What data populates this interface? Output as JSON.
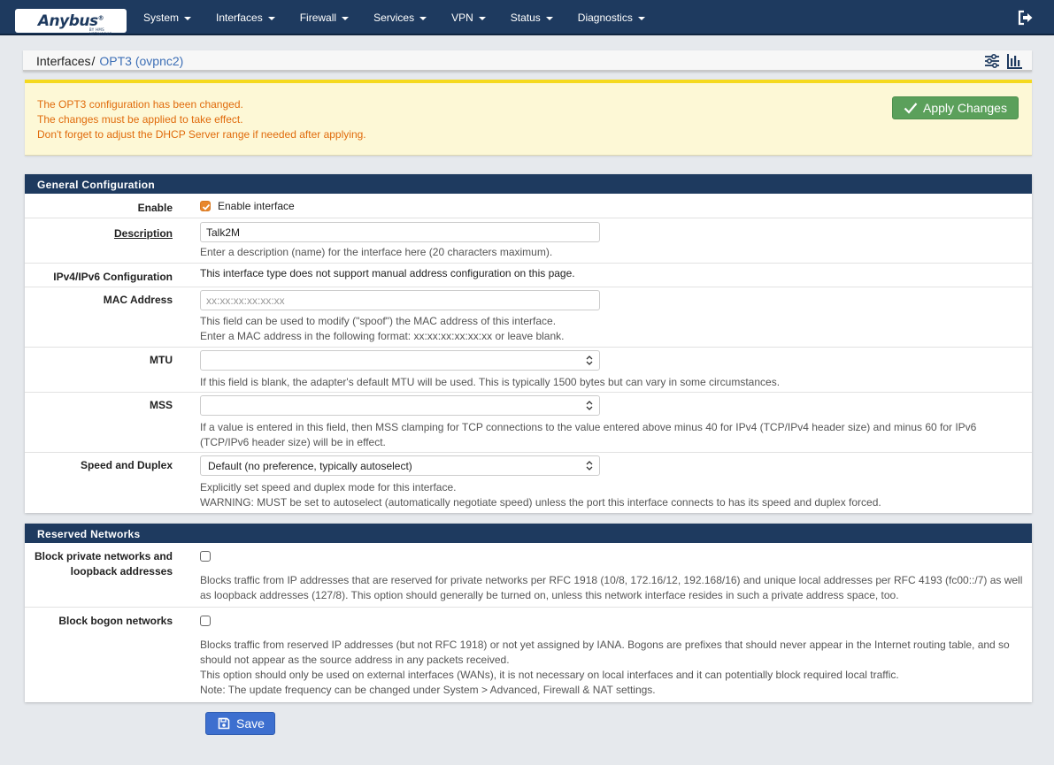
{
  "brand": {
    "name": "Anybus",
    "mark": "®",
    "tagline": "BY HMS NETWORKS"
  },
  "nav": {
    "items": [
      "System",
      "Interfaces",
      "Firewall",
      "Services",
      "VPN",
      "Status",
      "Diagnostics"
    ]
  },
  "breadcrumb": {
    "parent": "Interfaces",
    "separator": "/",
    "current": "OPT3 (ovpnc2)"
  },
  "alert": {
    "lines": [
      "The OPT3 configuration has been changed.",
      "The changes must be applied to take effect.",
      "Don't forget to adjust the DHCP Server range if needed after applying."
    ],
    "apply_label": "Apply Changes"
  },
  "general": {
    "title": "General Configuration",
    "enable_label": "Enable",
    "enable_checkbox_text": "Enable interface",
    "enable_checked": true,
    "description_label": "Description",
    "description_value": "Talk2M",
    "description_help": "Enter a description (name) for the interface here (20 characters maximum).",
    "ipconfig_label": "IPv4/IPv6 Configuration",
    "ipconfig_text": "This interface type does not support manual address configuration on this page.",
    "mac_label": "MAC Address",
    "mac_placeholder": "xx:xx:xx:xx:xx:xx",
    "mac_help_1": "This field can be used to modify (\"spoof\") the MAC address of this interface.",
    "mac_help_2": "Enter a MAC address in the following format: xx:xx:xx:xx:xx:xx or leave blank.",
    "mtu_label": "MTU",
    "mtu_value": "",
    "mtu_help": "If this field is blank, the adapter's default MTU will be used. This is typically 1500 bytes but can vary in some circumstances.",
    "mss_label": "MSS",
    "mss_value": "",
    "mss_help": "If a value is entered in this field, then MSS clamping for TCP connections to the value entered above minus 40 for IPv4 (TCP/IPv4 header size) and minus 60 for IPv6 (TCP/IPv6 header size) will be in effect.",
    "speed_label": "Speed and Duplex",
    "speed_value": "Default (no preference, typically autoselect)",
    "speed_help_1": "Explicitly set speed and duplex mode for this interface.",
    "speed_help_2": "WARNING: MUST be set to autoselect (automatically negotiate speed) unless the port this interface connects to has its speed and duplex forced."
  },
  "reserved": {
    "title": "Reserved Networks",
    "private_label_1": "Block private networks and",
    "private_label_2": "loopback addresses",
    "private_checked": false,
    "private_help": "Blocks traffic from IP addresses that are reserved for private networks per RFC 1918 (10/8, 172.16/12, 192.168/16) and unique local addresses per RFC 4193 (fc00::/7) as well as loopback addresses (127/8). This option should generally be turned on, unless this network interface resides in such a private address space, too.",
    "bogon_label": "Block bogon networks",
    "bogon_checked": false,
    "bogon_help_1": "Blocks traffic from reserved IP addresses (but not RFC 1918) or not yet assigned by IANA. Bogons are prefixes that should never appear in the Internet routing table, and so should not appear as the source address in any packets received.",
    "bogon_help_2": "This option should only be used on external interfaces (WANs), it is not necessary on local interfaces and it can potentially block required local traffic.",
    "bogon_help_3": "Note: The update frequency can be changed under System > Advanced, Firewall & NAT settings."
  },
  "save_label": "Save",
  "colors": {
    "nav": "#1e3a5f",
    "alert_text": "#e06b0c",
    "apply": "#5ba05b",
    "save": "#3d6fcf",
    "check": "#e8872c"
  }
}
